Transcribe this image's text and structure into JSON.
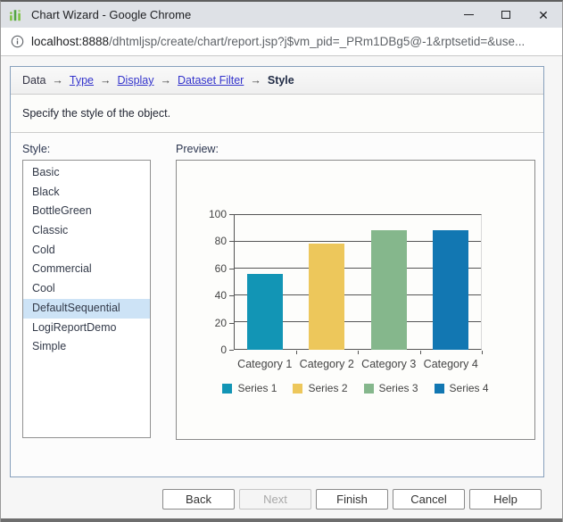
{
  "window": {
    "title": "Chart Wizard - Google Chrome"
  },
  "urlbar": {
    "host": "localhost:8888",
    "path": "/dhtmljsp/create/chart/report.jsp?j$vm_pid=_PRm1DBg5@-1&rptsetid=&use..."
  },
  "breadcrumb": {
    "arrow": "→",
    "items": [
      {
        "label": "Data",
        "type": "text"
      },
      {
        "label": "Type",
        "type": "link"
      },
      {
        "label": "Display",
        "type": "link"
      },
      {
        "label": "Dataset Filter",
        "type": "link"
      },
      {
        "label": "Style",
        "type": "current"
      }
    ]
  },
  "instruction": "Specify the style of the object.",
  "style_panel": {
    "label": "Style:",
    "options": [
      "Basic",
      "Black",
      "BottleGreen",
      "Classic",
      "Cold",
      "Commercial",
      "Cool",
      "DefaultSequential",
      "LogiReportDemo",
      "Simple"
    ],
    "selected": "DefaultSequential"
  },
  "preview_panel": {
    "label": "Preview:"
  },
  "chart_data": {
    "type": "bar",
    "title": "",
    "categories": [
      "Category 1",
      "Category 2",
      "Category 3",
      "Category 4"
    ],
    "series": [
      {
        "name": "Series 1",
        "color": "#1295b5",
        "value": 56
      },
      {
        "name": "Series 2",
        "color": "#edc75b",
        "value": 78
      },
      {
        "name": "Series 3",
        "color": "#85b78c",
        "value": 88
      },
      {
        "name": "Series 4",
        "color": "#1277b2",
        "value": 88
      }
    ],
    "ylim": [
      0,
      100
    ],
    "yticks": [
      0,
      20,
      40,
      60,
      80,
      100
    ],
    "grid": true,
    "legend_position": "bottom"
  },
  "buttons": [
    {
      "label": "Back",
      "enabled": true
    },
    {
      "label": "Next",
      "enabled": false
    },
    {
      "label": "Finish",
      "enabled": true
    },
    {
      "label": "Cancel",
      "enabled": true
    },
    {
      "label": "Help",
      "enabled": true
    }
  ],
  "colors": {
    "titlebar_bg": "#dee1e6",
    "panel_border": "#87a0bc",
    "selection_bg": "#cde3f6",
    "link": "#3333cc",
    "favicon_green": "#7dc242",
    "favicon_dark_green": "#55a546"
  }
}
